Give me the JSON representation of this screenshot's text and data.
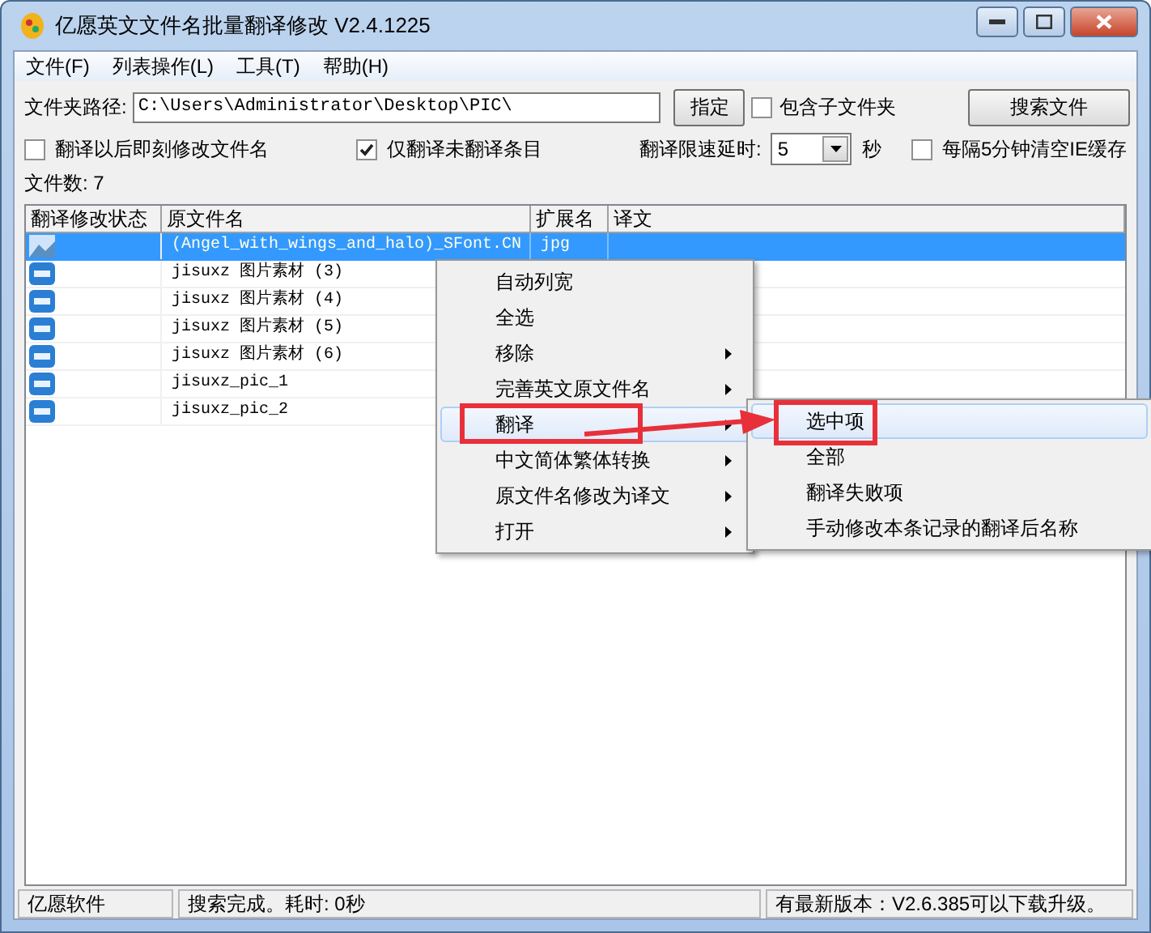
{
  "window": {
    "title": "亿愿英文文件名批量翻译修改 V2.4.1225"
  },
  "menu": [
    "文件(F)",
    "列表操作(L)",
    "工具(T)",
    "帮助(H)"
  ],
  "folder": {
    "label": "文件夹路径:",
    "value": "C:\\Users\\Administrator\\Desktop\\PIC\\",
    "button": "指定",
    "include_sub": {
      "label": "包含子文件夹",
      "checked": false
    },
    "search_button": "搜索文件"
  },
  "options": [
    {
      "label": "翻译以后即刻修改文件名",
      "checked": false
    },
    {
      "label": "仅翻译未翻译条目",
      "checked": true
    }
  ],
  "delay": {
    "label": "翻译限速延时:",
    "value": "5",
    "unit": "秒"
  },
  "clear_cache": {
    "label": "每隔5分钟清空IE缓存",
    "checked": false
  },
  "file_count": "文件数: 7",
  "table": {
    "columns": [
      "翻译修改状态",
      "原文件名",
      "扩展名",
      "译文"
    ],
    "rows": [
      {
        "kind": "image",
        "name": "(Angel_with_wings_and_halo)_SFont.CN",
        "ext": "jpg",
        "selected": true
      },
      {
        "kind": "jpg",
        "name": "jisuxz 图片素材 (3)",
        "selected": false
      },
      {
        "kind": "jpg",
        "name": "jisuxz 图片素材 (4)",
        "selected": false
      },
      {
        "kind": "jpg",
        "name": "jisuxz 图片素材 (5)",
        "selected": false
      },
      {
        "kind": "jpg",
        "name": "jisuxz 图片素材 (6)",
        "selected": false
      },
      {
        "kind": "jpg",
        "name": "jisuxz_pic_1",
        "selected": false
      },
      {
        "kind": "jpg",
        "name": "jisuxz_pic_2",
        "selected": false
      }
    ]
  },
  "context_menu": [
    {
      "label": "自动列宽",
      "submenu": false,
      "selected": false
    },
    {
      "label": "全选",
      "submenu": false,
      "selected": false
    },
    {
      "label": "移除",
      "submenu": true,
      "selected": false
    },
    {
      "label": "完善英文原文件名",
      "submenu": true,
      "selected": false
    },
    {
      "label": "翻译",
      "submenu": true,
      "selected": true
    },
    {
      "label": "中文简体繁体转换",
      "submenu": true,
      "selected": false
    },
    {
      "label": "原文件名修改为译文",
      "submenu": true,
      "selected": false
    },
    {
      "label": "打开",
      "submenu": true,
      "selected": false
    }
  ],
  "submenu": [
    {
      "label": "选中项",
      "selected": true
    },
    {
      "label": "全部",
      "selected": false
    },
    {
      "label": "翻译失败项",
      "selected": false
    },
    {
      "label": "手动修改本条记录的翻译后名称",
      "selected": false
    }
  ],
  "status_bar": [
    "亿愿软件",
    "搜索完成。耗时: 0秒",
    "有最新版本：V2.6.385可以下载升级。"
  ]
}
